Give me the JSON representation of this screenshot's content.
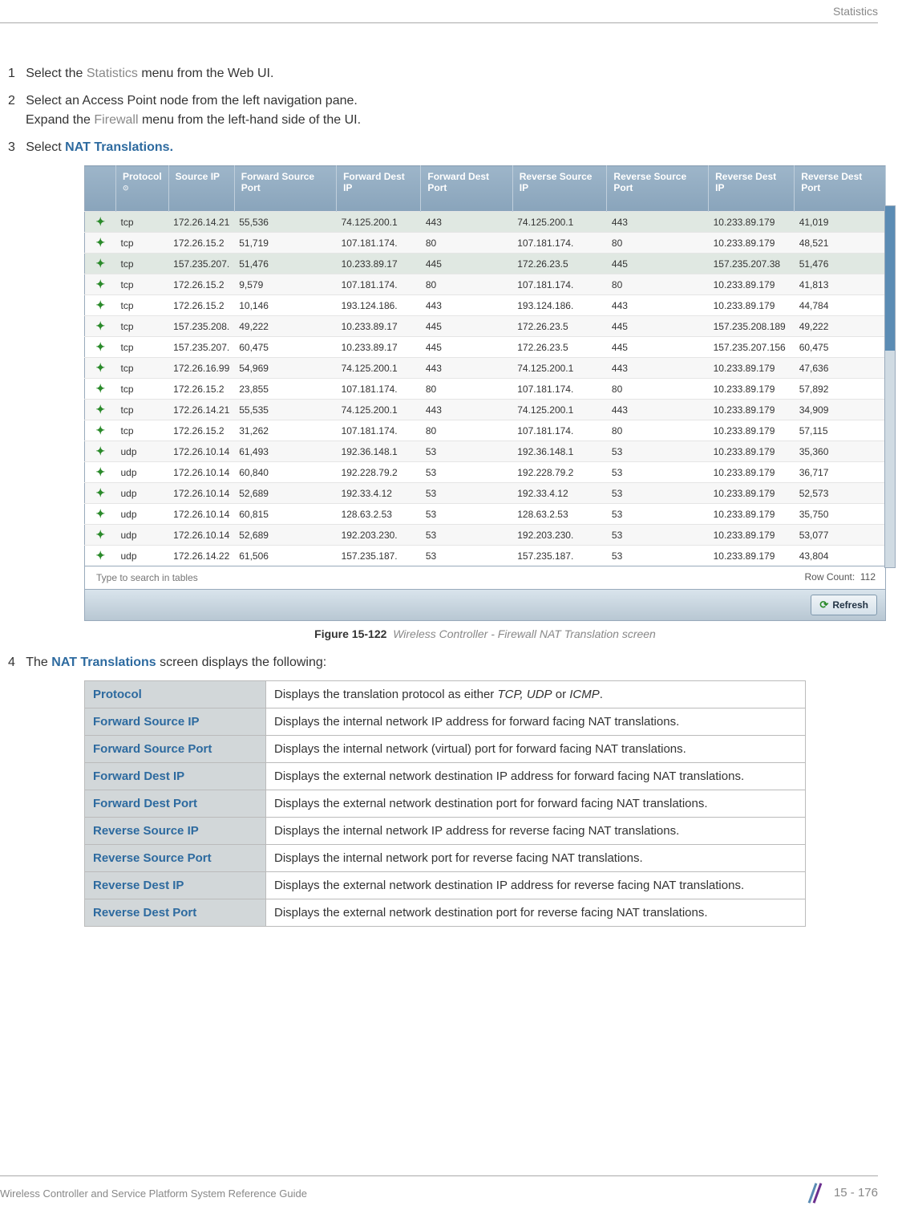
{
  "header": {
    "section": "Statistics"
  },
  "steps": [
    {
      "num": "1",
      "before": "Select the ",
      "muted": "Statistics",
      "after": " menu from the Web UI."
    },
    {
      "num": "2",
      "line1": "Select an Access Point node from the left navigation pane.",
      "line2_before": "Expand the ",
      "line2_muted": "Firewall",
      "line2_after": " menu from the left-hand side of the UI."
    },
    {
      "num": "3",
      "before": "Select ",
      "bold": "NAT Translations."
    },
    {
      "num": "4",
      "before": "The ",
      "bold": "NAT Translations",
      "after": " screen displays the following:"
    }
  ],
  "nat_headers": [
    "",
    "Protocol",
    "Source IP",
    "Forward Source Port",
    "Forward Dest IP",
    "Forward Dest Port",
    "Reverse Source IP",
    "Reverse Source Port",
    "Reverse Dest IP",
    "Reverse Dest Port"
  ],
  "sort_indicator": "⊙",
  "nat_rows": [
    [
      "tcp",
      "172.26.14.21",
      "55,536",
      "74.125.200.1",
      "443",
      "74.125.200.1",
      "443",
      "10.233.89.179",
      "41,019"
    ],
    [
      "tcp",
      "172.26.15.2",
      "51,719",
      "107.181.174.",
      "80",
      "107.181.174.",
      "80",
      "10.233.89.179",
      "48,521"
    ],
    [
      "tcp",
      "157.235.207.",
      "51,476",
      "10.233.89.17",
      "445",
      "172.26.23.5",
      "445",
      "157.235.207.38",
      "51,476"
    ],
    [
      "tcp",
      "172.26.15.2",
      "9,579",
      "107.181.174.",
      "80",
      "107.181.174.",
      "80",
      "10.233.89.179",
      "41,813"
    ],
    [
      "tcp",
      "172.26.15.2",
      "10,146",
      "193.124.186.",
      "443",
      "193.124.186.",
      "443",
      "10.233.89.179",
      "44,784"
    ],
    [
      "tcp",
      "157.235.208.",
      "49,222",
      "10.233.89.17",
      "445",
      "172.26.23.5",
      "445",
      "157.235.208.189",
      "49,222"
    ],
    [
      "tcp",
      "157.235.207.",
      "60,475",
      "10.233.89.17",
      "445",
      "172.26.23.5",
      "445",
      "157.235.207.156",
      "60,475"
    ],
    [
      "tcp",
      "172.26.16.99",
      "54,969",
      "74.125.200.1",
      "443",
      "74.125.200.1",
      "443",
      "10.233.89.179",
      "47,636"
    ],
    [
      "tcp",
      "172.26.15.2",
      "23,855",
      "107.181.174.",
      "80",
      "107.181.174.",
      "80",
      "10.233.89.179",
      "57,892"
    ],
    [
      "tcp",
      "172.26.14.21",
      "55,535",
      "74.125.200.1",
      "443",
      "74.125.200.1",
      "443",
      "10.233.89.179",
      "34,909"
    ],
    [
      "tcp",
      "172.26.15.2",
      "31,262",
      "107.181.174.",
      "80",
      "107.181.174.",
      "80",
      "10.233.89.179",
      "57,115"
    ],
    [
      "udp",
      "172.26.10.14",
      "61,493",
      "192.36.148.1",
      "53",
      "192.36.148.1",
      "53",
      "10.233.89.179",
      "35,360"
    ],
    [
      "udp",
      "172.26.10.14",
      "60,840",
      "192.228.79.2",
      "53",
      "192.228.79.2",
      "53",
      "10.233.89.179",
      "36,717"
    ],
    [
      "udp",
      "172.26.10.14",
      "52,689",
      "192.33.4.12",
      "53",
      "192.33.4.12",
      "53",
      "10.233.89.179",
      "52,573"
    ],
    [
      "udp",
      "172.26.10.14",
      "60,815",
      "128.63.2.53",
      "53",
      "128.63.2.53",
      "53",
      "10.233.89.179",
      "35,750"
    ],
    [
      "udp",
      "172.26.10.14",
      "52,689",
      "192.203.230.",
      "53",
      "192.203.230.",
      "53",
      "10.233.89.179",
      "53,077"
    ],
    [
      "udp",
      "172.26.14.22",
      "61,506",
      "157.235.187.",
      "53",
      "157.235.187.",
      "53",
      "10.233.89.179",
      "43,804"
    ]
  ],
  "table_footer": {
    "search_placeholder": "Type to search in tables",
    "row_count_label": "Row Count:",
    "row_count_value": "112",
    "refresh": "Refresh"
  },
  "figure": {
    "label": "Figure 15-122",
    "title": "Wireless Controller - Firewall NAT Translation screen"
  },
  "desc_rows": [
    {
      "term": "Protocol",
      "desc_before": "Displays the translation protocol as either ",
      "ital": "TCP, UDP",
      "desc_mid": " or ",
      "ital2": "ICMP",
      "desc_after": "."
    },
    {
      "term": "Forward Source IP",
      "desc": "Displays the internal network IP address for forward facing NAT translations."
    },
    {
      "term": "Forward Source Port",
      "desc": "Displays the internal network (virtual) port for forward facing NAT translations."
    },
    {
      "term": "Forward Dest IP",
      "desc": "Displays the external network destination IP address for forward facing NAT translations."
    },
    {
      "term": "Forward Dest Port",
      "desc": "Displays the external network destination port for forward facing NAT translations."
    },
    {
      "term": "Reverse Source IP",
      "desc": "Displays the internal network IP address for reverse facing NAT translations."
    },
    {
      "term": "Reverse Source Port",
      "desc": "Displays the internal network port for reverse facing NAT translations."
    },
    {
      "term": "Reverse Dest IP",
      "desc": "Displays the external network destination IP address for reverse facing NAT translations."
    },
    {
      "term": "Reverse Dest Port",
      "desc": "Displays the external network destination port for reverse facing NAT translations."
    }
  ],
  "footer": {
    "guide": "Wireless Controller and Service Platform System Reference Guide",
    "page": "15 - 176"
  }
}
